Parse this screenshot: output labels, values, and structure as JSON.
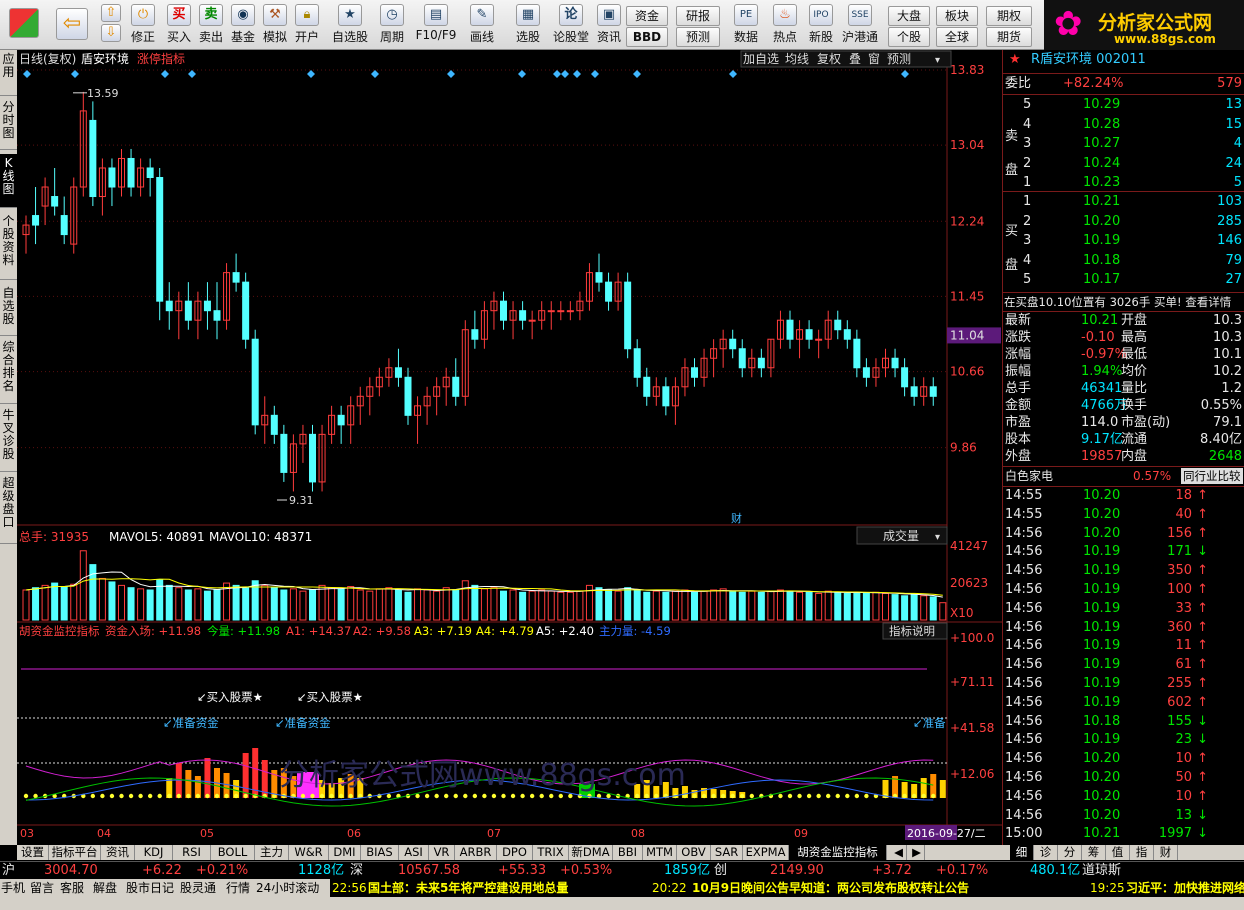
{
  "toolbar": {
    "buttons": [
      "买入",
      "卖出",
      "基金",
      "模拟",
      "开户",
      "自选股",
      "周期",
      "F10/F9",
      "画线",
      "选股",
      "论股堂",
      "资讯",
      "数据",
      "热点",
      "新股",
      "沪港通"
    ],
    "repair": "修正",
    "small_buttons": [
      "资金",
      "研报",
      "BBD",
      "预测",
      "大盘",
      "板块",
      "期权",
      "个股",
      "全球",
      "期货"
    ],
    "logo_title": "分析家公式网",
    "logo_url": "www.88gs.com"
  },
  "left_tabs": [
    "应用",
    "分时图",
    "K线图",
    "个股资料",
    "自选股",
    "综合排名",
    "牛叉诊股",
    "超级盘口"
  ],
  "chart_header": {
    "period": "日线(复权)",
    "stock_name": "盾安环境",
    "indicator_link": "涨停指标",
    "buttons": [
      "加自选",
      "均线",
      "复权",
      "叠",
      "窗",
      "预测"
    ]
  },
  "chart_data": [
    {
      "type": "candlestick",
      "title": "日线(复权) 盾安环境",
      "y_ticks": [
        "13.83",
        "13.04",
        "12.24",
        "11.45",
        "10.66",
        "9.86"
      ],
      "ylim": [
        9.31,
        13.83
      ],
      "current_price": "11.04",
      "annotations": {
        "high": "13.59",
        "low": "9.31",
        "marker": "财"
      },
      "x_ticks": [
        "03",
        "04",
        "05",
        "06",
        "07",
        "08",
        "09"
      ],
      "date_label": "2016-09-27/二",
      "candles": [
        [
          12.1,
          12.3,
          11.9,
          12.2
        ],
        [
          12.3,
          12.6,
          12.0,
          12.2
        ],
        [
          12.4,
          12.7,
          12.2,
          12.6
        ],
        [
          12.5,
          12.8,
          12.3,
          12.4
        ],
        [
          12.3,
          12.5,
          12.0,
          12.1
        ],
        [
          12.0,
          12.7,
          11.9,
          12.6
        ],
        [
          12.6,
          13.6,
          12.5,
          13.4
        ],
        [
          13.3,
          13.5,
          12.4,
          12.5
        ],
        [
          12.5,
          12.9,
          12.3,
          12.8
        ],
        [
          12.8,
          12.9,
          12.4,
          12.6
        ],
        [
          12.6,
          13.0,
          12.5,
          12.9
        ],
        [
          12.9,
          13.0,
          12.5,
          12.6
        ],
        [
          12.6,
          12.9,
          12.5,
          12.8
        ],
        [
          12.8,
          12.9,
          12.5,
          12.7
        ],
        [
          12.7,
          12.8,
          11.2,
          11.4
        ],
        [
          11.4,
          11.6,
          11.1,
          11.3
        ],
        [
          11.3,
          11.5,
          11.0,
          11.4
        ],
        [
          11.4,
          11.6,
          11.1,
          11.2
        ],
        [
          11.2,
          11.5,
          11.0,
          11.4
        ],
        [
          11.4,
          11.6,
          11.1,
          11.3
        ],
        [
          11.3,
          11.6,
          11.0,
          11.2
        ],
        [
          11.2,
          11.8,
          11.1,
          11.7
        ],
        [
          11.7,
          11.9,
          11.5,
          11.6
        ],
        [
          11.6,
          11.7,
          10.9,
          11.0
        ],
        [
          11.0,
          11.1,
          10.0,
          10.1
        ],
        [
          10.1,
          10.4,
          9.9,
          10.2
        ],
        [
          10.2,
          10.3,
          9.9,
          10.0
        ],
        [
          10.0,
          10.1,
          9.5,
          9.6
        ],
        [
          9.6,
          10.0,
          9.4,
          9.9
        ],
        [
          9.9,
          10.1,
          9.7,
          10.0
        ],
        [
          10.0,
          10.1,
          9.4,
          9.5
        ],
        [
          9.5,
          10.1,
          9.4,
          10.0
        ],
        [
          10.0,
          10.3,
          9.9,
          10.2
        ],
        [
          10.2,
          10.3,
          9.9,
          10.1
        ],
        [
          10.1,
          10.4,
          9.9,
          10.3
        ],
        [
          10.3,
          10.5,
          10.1,
          10.4
        ],
        [
          10.4,
          10.6,
          10.2,
          10.5
        ],
        [
          10.5,
          10.7,
          10.4,
          10.6
        ],
        [
          10.6,
          10.8,
          10.5,
          10.7
        ],
        [
          10.7,
          10.9,
          10.5,
          10.6
        ],
        [
          10.6,
          10.7,
          10.1,
          10.2
        ],
        [
          10.2,
          10.4,
          9.9,
          10.3
        ],
        [
          10.3,
          10.5,
          10.1,
          10.4
        ],
        [
          10.4,
          10.6,
          10.2,
          10.5
        ],
        [
          10.5,
          10.7,
          10.3,
          10.6
        ],
        [
          10.6,
          10.8,
          10.3,
          10.4
        ],
        [
          10.4,
          11.2,
          10.3,
          11.1
        ],
        [
          11.1,
          11.3,
          10.9,
          11.0
        ],
        [
          11.0,
          11.4,
          10.9,
          11.3
        ],
        [
          11.3,
          11.5,
          11.1,
          11.4
        ],
        [
          11.4,
          11.5,
          11.1,
          11.2
        ],
        [
          11.2,
          11.4,
          11.0,
          11.3
        ],
        [
          11.3,
          11.4,
          11.1,
          11.2
        ],
        [
          11.2,
          11.3,
          11.0,
          11.2
        ],
        [
          11.2,
          11.4,
          11.1,
          11.3
        ],
        [
          11.3,
          11.4,
          11.1,
          11.3
        ],
        [
          11.3,
          11.4,
          11.2,
          11.3
        ],
        [
          11.3,
          11.4,
          11.2,
          11.3
        ],
        [
          11.3,
          11.5,
          11.2,
          11.4
        ],
        [
          11.4,
          11.8,
          11.3,
          11.7
        ],
        [
          11.7,
          11.9,
          11.5,
          11.6
        ],
        [
          11.6,
          11.7,
          11.3,
          11.4
        ],
        [
          11.4,
          11.7,
          11.3,
          11.6
        ],
        [
          11.6,
          11.7,
          10.8,
          10.9
        ],
        [
          10.9,
          11.0,
          10.5,
          10.6
        ],
        [
          10.6,
          10.7,
          10.3,
          10.4
        ],
        [
          10.4,
          10.6,
          10.3,
          10.5
        ],
        [
          10.5,
          10.6,
          10.2,
          10.3
        ],
        [
          10.3,
          10.6,
          10.1,
          10.5
        ],
        [
          10.5,
          10.8,
          10.4,
          10.7
        ],
        [
          10.7,
          10.8,
          10.5,
          10.6
        ],
        [
          10.6,
          10.9,
          10.5,
          10.8
        ],
        [
          10.8,
          11.0,
          10.6,
          10.9
        ],
        [
          10.9,
          11.1,
          10.7,
          11.0
        ],
        [
          11.0,
          11.1,
          10.8,
          10.9
        ],
        [
          10.9,
          11.0,
          10.6,
          10.7
        ],
        [
          10.7,
          10.9,
          10.6,
          10.8
        ],
        [
          10.8,
          10.9,
          10.6,
          10.7
        ],
        [
          10.7,
          11.0,
          10.6,
          11.0
        ],
        [
          11.0,
          11.3,
          10.9,
          11.2
        ],
        [
          11.2,
          11.3,
          10.9,
          11.0
        ],
        [
          11.0,
          11.2,
          10.8,
          11.1
        ],
        [
          11.1,
          11.2,
          10.9,
          11.0
        ],
        [
          11.0,
          11.1,
          10.8,
          11.0
        ],
        [
          11.0,
          11.3,
          10.9,
          11.2
        ],
        [
          11.2,
          11.3,
          11.0,
          11.1
        ],
        [
          11.1,
          11.2,
          10.9,
          11.0
        ],
        [
          11.0,
          11.1,
          10.6,
          10.7
        ],
        [
          10.7,
          10.8,
          10.5,
          10.6
        ],
        [
          10.6,
          10.8,
          10.5,
          10.7
        ],
        [
          10.7,
          10.9,
          10.6,
          10.8
        ],
        [
          10.8,
          10.9,
          10.6,
          10.7
        ],
        [
          10.7,
          10.8,
          10.4,
          10.5
        ],
        [
          10.5,
          10.6,
          10.3,
          10.4
        ],
        [
          10.4,
          10.6,
          10.3,
          10.5
        ],
        [
          10.5,
          10.6,
          10.3,
          10.4
        ]
      ]
    },
    {
      "type": "bar",
      "title": "总手",
      "legend": {
        "vol_label": "总手: 31935",
        "ma5": "MAVOL5: 40891",
        "ma10": "MAVOL10: 48371"
      },
      "y_ticks": [
        "41247",
        "20623",
        "X10"
      ],
      "selector": "成交量",
      "values": [
        26,
        28,
        30,
        32,
        29,
        31,
        60,
        48,
        36,
        33,
        30,
        28,
        27,
        26,
        35,
        30,
        28,
        26,
        27,
        25,
        26,
        32,
        30,
        28,
        34,
        30,
        28,
        26,
        27,
        25,
        26,
        30,
        28,
        27,
        29,
        26,
        25,
        27,
        28,
        26,
        24,
        27,
        26,
        25,
        28,
        26,
        34,
        30,
        27,
        28,
        25,
        26,
        24,
        25,
        26,
        25,
        24,
        24,
        25,
        30,
        28,
        26,
        25,
        28,
        26,
        24,
        25,
        24,
        25,
        26,
        24,
        25,
        26,
        27,
        25,
        24,
        25,
        24,
        25,
        26,
        25,
        24,
        24,
        23,
        25,
        24,
        23,
        24,
        23,
        24,
        23,
        22,
        21,
        22,
        21,
        20,
        15
      ]
    },
    {
      "type": "line",
      "title": "胡资金监控指标",
      "legend": [
        "资金入场: +11.98",
        "今量: +11.98",
        "A1: +14.37",
        "A2: +9.58",
        "A3: +7.19",
        "A4: +4.79",
        "A5: +2.40",
        "主力量: -4.59"
      ],
      "y_ticks": [
        "+100.0",
        "+71.11",
        "+41.58",
        "+12.06"
      ],
      "annotations": [
        "买入股票★",
        "买入股票★",
        "准备资金",
        "准备资金",
        "准备"
      ],
      "help_button": "指标说明",
      "watermark": "分析家公式网www.88gs.com"
    }
  ],
  "quote": {
    "title": "R盾安环境 002011",
    "ratio_label": "委比",
    "ratio_value": "+82.24%",
    "ratio_vol": "579",
    "sell_label": "卖盘",
    "buy_label": "买盘",
    "sells": [
      [
        "5",
        "10.29",
        "13"
      ],
      [
        "4",
        "10.28",
        "15"
      ],
      [
        "3",
        "10.27",
        "4"
      ],
      [
        "2",
        "10.24",
        "24"
      ],
      [
        "1",
        "10.23",
        "5"
      ]
    ],
    "buys": [
      [
        "1",
        "10.21",
        "103"
      ],
      [
        "2",
        "10.20",
        "285"
      ],
      [
        "3",
        "10.19",
        "146"
      ],
      [
        "4",
        "10.18",
        "79"
      ],
      [
        "5",
        "10.17",
        "27"
      ]
    ],
    "notice": "在买盘10.10位置有 3026手 买单! 查看详情",
    "stats": [
      [
        "最新",
        "10.21",
        "开盘",
        "10.3"
      ],
      [
        "涨跌",
        "-0.10",
        "最高",
        "10.3"
      ],
      [
        "涨幅",
        "-0.97%",
        "最低",
        "10.1"
      ],
      [
        "振幅",
        "1.94%",
        "均价",
        "10.2"
      ],
      [
        "总手",
        "46341",
        "量比",
        "1.2"
      ],
      [
        "金额",
        "4766万",
        "换手",
        "0.55%"
      ],
      [
        "市盈",
        "114.0",
        "市盈(动)",
        "79.1"
      ],
      [
        "股本",
        "9.17亿",
        "流通",
        "8.40亿"
      ],
      [
        "外盘",
        "19857",
        "内盘",
        "2648"
      ]
    ],
    "sector_name": "白色家电",
    "sector_pct": "0.57%",
    "sector_btn": "同行业比较",
    "ticks": [
      [
        "14:55",
        "10.20",
        "18",
        "r"
      ],
      [
        "14:55",
        "10.20",
        "40",
        "r"
      ],
      [
        "14:56",
        "10.20",
        "156",
        "r"
      ],
      [
        "14:56",
        "10.19",
        "171",
        "g"
      ],
      [
        "14:56",
        "10.19",
        "350",
        "r"
      ],
      [
        "14:56",
        "10.19",
        "100",
        "r"
      ],
      [
        "14:56",
        "10.19",
        "33",
        "r"
      ],
      [
        "14:56",
        "10.19",
        "360",
        "r"
      ],
      [
        "14:56",
        "10.19",
        "11",
        "r"
      ],
      [
        "14:56",
        "10.19",
        "61",
        "r"
      ],
      [
        "14:56",
        "10.19",
        "255",
        "r"
      ],
      [
        "14:56",
        "10.19",
        "602",
        "r"
      ],
      [
        "14:56",
        "10.18",
        "155",
        "g"
      ],
      [
        "14:56",
        "10.19",
        "23",
        "g"
      ],
      [
        "14:56",
        "10.20",
        "10",
        "r"
      ],
      [
        "14:56",
        "10.20",
        "50",
        "r"
      ],
      [
        "14:56",
        "10.20",
        "10",
        "r"
      ],
      [
        "14:56",
        "10.20",
        "13",
        "g"
      ],
      [
        "15:00",
        "10.21",
        "1997",
        "g"
      ]
    ]
  },
  "bottom_tabs": [
    "设置",
    "指标平台",
    "资讯",
    "KDJ",
    "RSI",
    "BOLL",
    "主力",
    "W&R",
    "DMI",
    "BIAS",
    "ASI",
    "VR",
    "ARBR",
    "DPO",
    "TRIX",
    "新DMA",
    "BBI",
    "MTM",
    "OBV",
    "SAR",
    "EXPMA",
    "胡资金监控指标"
  ],
  "right_tabs": [
    "细",
    "诊",
    "分",
    "筹",
    "值",
    "指",
    "财"
  ],
  "status": {
    "sh_label": "沪",
    "sh_index": "3004.70",
    "sh_chg": "+6.22",
    "sh_pct": "+0.21%",
    "sh_amt": "1128亿",
    "sz_label": "深",
    "sz_index": "10567.58",
    "sz_chg": "+55.33",
    "sz_pct": "+0.53%",
    "sz_amt": "1859亿",
    "cy_label": "创",
    "cy_index": "2149.90",
    "cy_chg": "+3.72",
    "cy_pct": "+0.17%",
    "cy_amt": "480.1亿",
    "dj_label": "道琼斯"
  },
  "status2": {
    "links": [
      "手机",
      "留言",
      "客服",
      "解盘",
      "股市日记",
      "股灵通",
      "行情",
      "24小时滚动"
    ],
    "news": [
      {
        "time": "22:56",
        "text": "国土部：未来5年将严控建设用地总量"
      },
      {
        "time": "20:22",
        "text": "10月9日晚间公告早知道：两公司发布股权转让公告"
      },
      {
        "time": "19:25",
        "text": "习近平：加快推进网络"
      }
    ]
  }
}
